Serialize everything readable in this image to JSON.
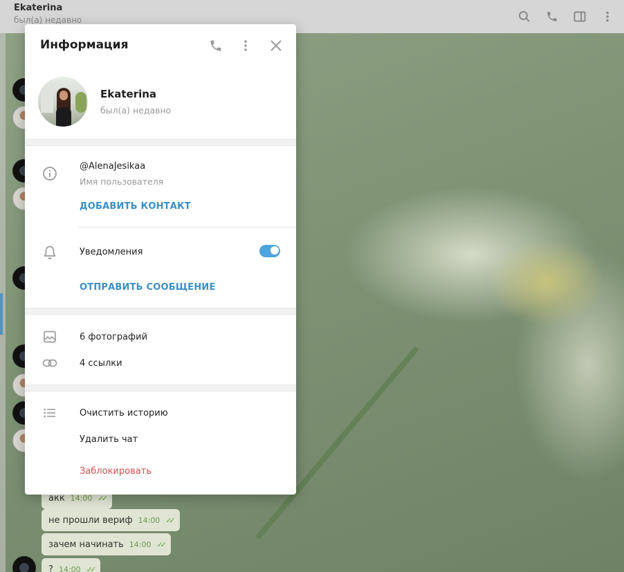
{
  "chat": {
    "title": "Ekaterina",
    "status": "был(а) недавно",
    "header_icons": [
      "search-icon",
      "phone-icon",
      "sidebar-toggle-icon",
      "more-vertical-icon"
    ]
  },
  "messages": [
    {
      "text": "акк",
      "time": "14:00"
    },
    {
      "text": "не прошли вериф",
      "time": "14:00"
    },
    {
      "text": "зачем начинать",
      "time": "14:00"
    },
    {
      "text": "?",
      "time": "14:00"
    }
  ],
  "modal": {
    "title": "Информация",
    "profile": {
      "name": "Ekaterina",
      "status": "был(а) недавно"
    },
    "username": {
      "value": "@AlenaJesikaa",
      "caption": "Имя пользователя"
    },
    "add_contact_label": "ДОБАВИТЬ КОНТАКТ",
    "notifications": {
      "label": "Уведомления",
      "enabled": true
    },
    "send_message_label": "ОТПРАВИТЬ СООБЩЕНИЕ",
    "media": {
      "photos_label": "6 фотографий",
      "links_label": "4 ссылки"
    },
    "actions": {
      "clear_history": "Очистить историю",
      "delete_chat": "Удалить чат",
      "block": "Заблокировать"
    }
  },
  "colors": {
    "accent": "#3a8fc7",
    "danger": "#d0514a",
    "toggle_on": "#4ea4dc"
  }
}
